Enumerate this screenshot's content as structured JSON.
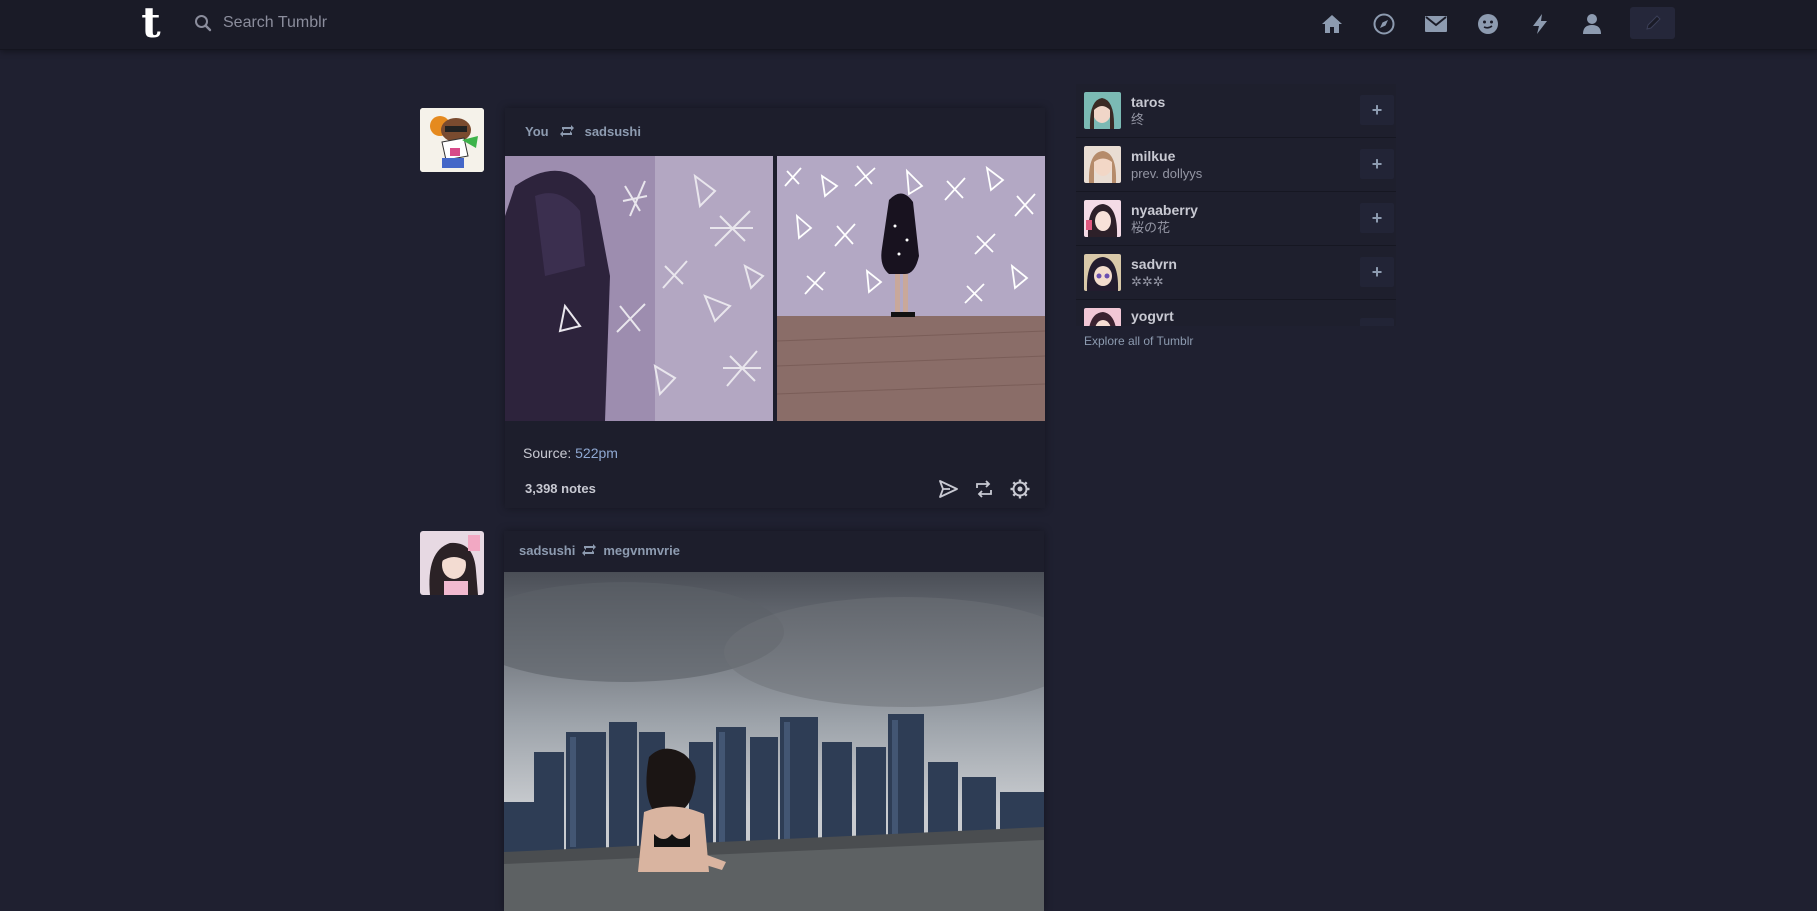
{
  "topbar": {
    "logo": "t",
    "search_placeholder": "Search Tumblr",
    "nav_icons": [
      "home-icon",
      "explore-icon",
      "inbox-icon",
      "messages-icon",
      "activity-icon",
      "account-icon"
    ],
    "compose_icon": "pencil-icon"
  },
  "posts": [
    {
      "header_left": "You",
      "header_right": "sadsushi",
      "source_label": "Source:",
      "source_link": "522pm",
      "notes": "3,398 notes"
    },
    {
      "header_left": "sadsushi",
      "header_right": "megvnmvrie"
    }
  ],
  "sidebar": {
    "recommendations": [
      {
        "name": "taros",
        "sub": "终"
      },
      {
        "name": "milkue",
        "sub": "prev. dollyys"
      },
      {
        "name": "nyaaberry",
        "sub": "桜の花"
      },
      {
        "name": "sadvrn",
        "sub": "✲✲✲"
      },
      {
        "name": "yogvrt",
        "sub": ""
      }
    ],
    "follow_label": "+",
    "explore": "Explore all of Tumblr"
  },
  "colors": {
    "background": "#1f2030",
    "topbar": "#1a1b27",
    "accent_link": "#8fa8d2",
    "username": "#8d9bb0"
  }
}
